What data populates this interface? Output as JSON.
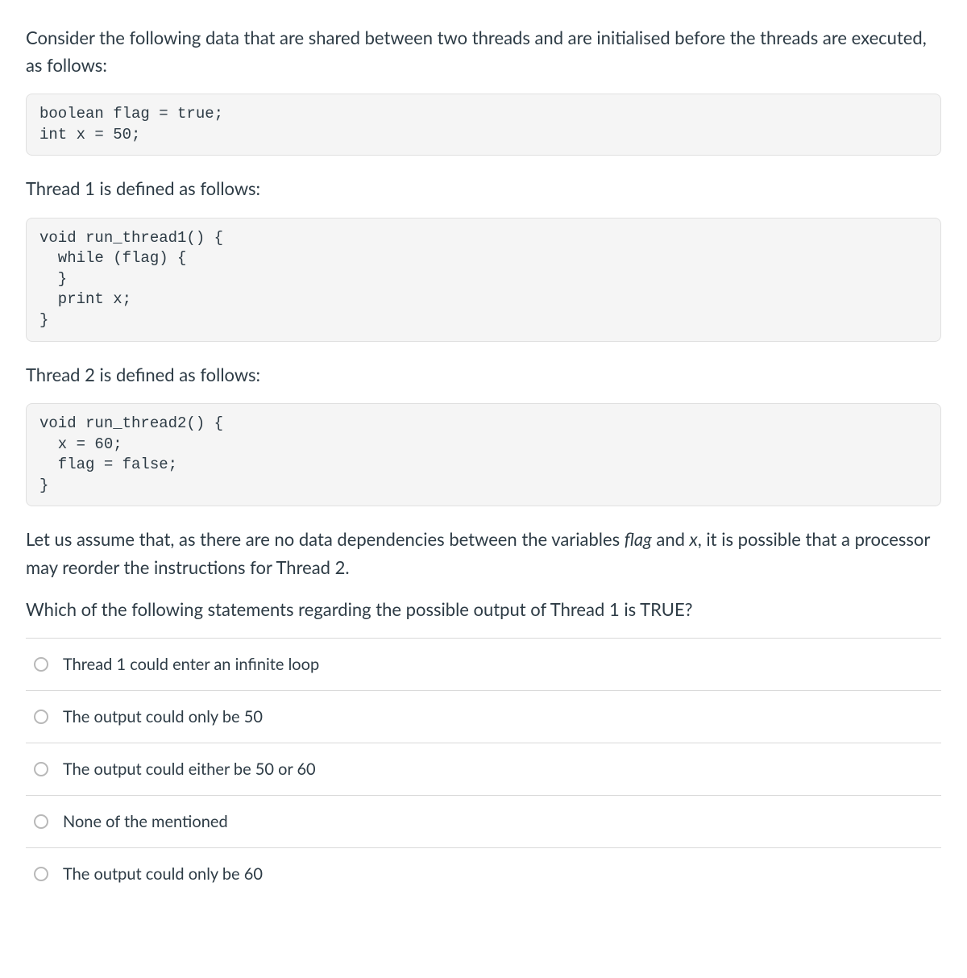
{
  "question": {
    "intro": "Consider the following data that are shared between two threads and are initialised before the threads are executed, as follows:",
    "code1": "boolean flag = true;\nint x = 50;",
    "thread1_label": "Thread 1 is defined as follows:",
    "code2": "void run_thread1() {\n  while (flag) {\n  }\n  print x;\n}",
    "thread2_label": "Thread 2 is defined as follows:",
    "code3": "void run_thread2() {\n  x = 60;\n  flag = false;\n}",
    "assumption_prefix": "Let us assume that, as there are no data dependencies between the variables ",
    "assumption_var1": "flag",
    "assumption_mid": " and ",
    "assumption_var2": "x",
    "assumption_suffix": ", it is possible that a processor may reorder the instructions for Thread 2.",
    "prompt": "Which of the following statements regarding the possible output of Thread 1 is TRUE?"
  },
  "answers": [
    {
      "label": "Thread 1 could enter an infinite loop"
    },
    {
      "label": "The output could only be 50"
    },
    {
      "label": "The output could either be 50 or 60"
    },
    {
      "label": "None of the mentioned"
    },
    {
      "label": "The output could only be 60"
    }
  ]
}
